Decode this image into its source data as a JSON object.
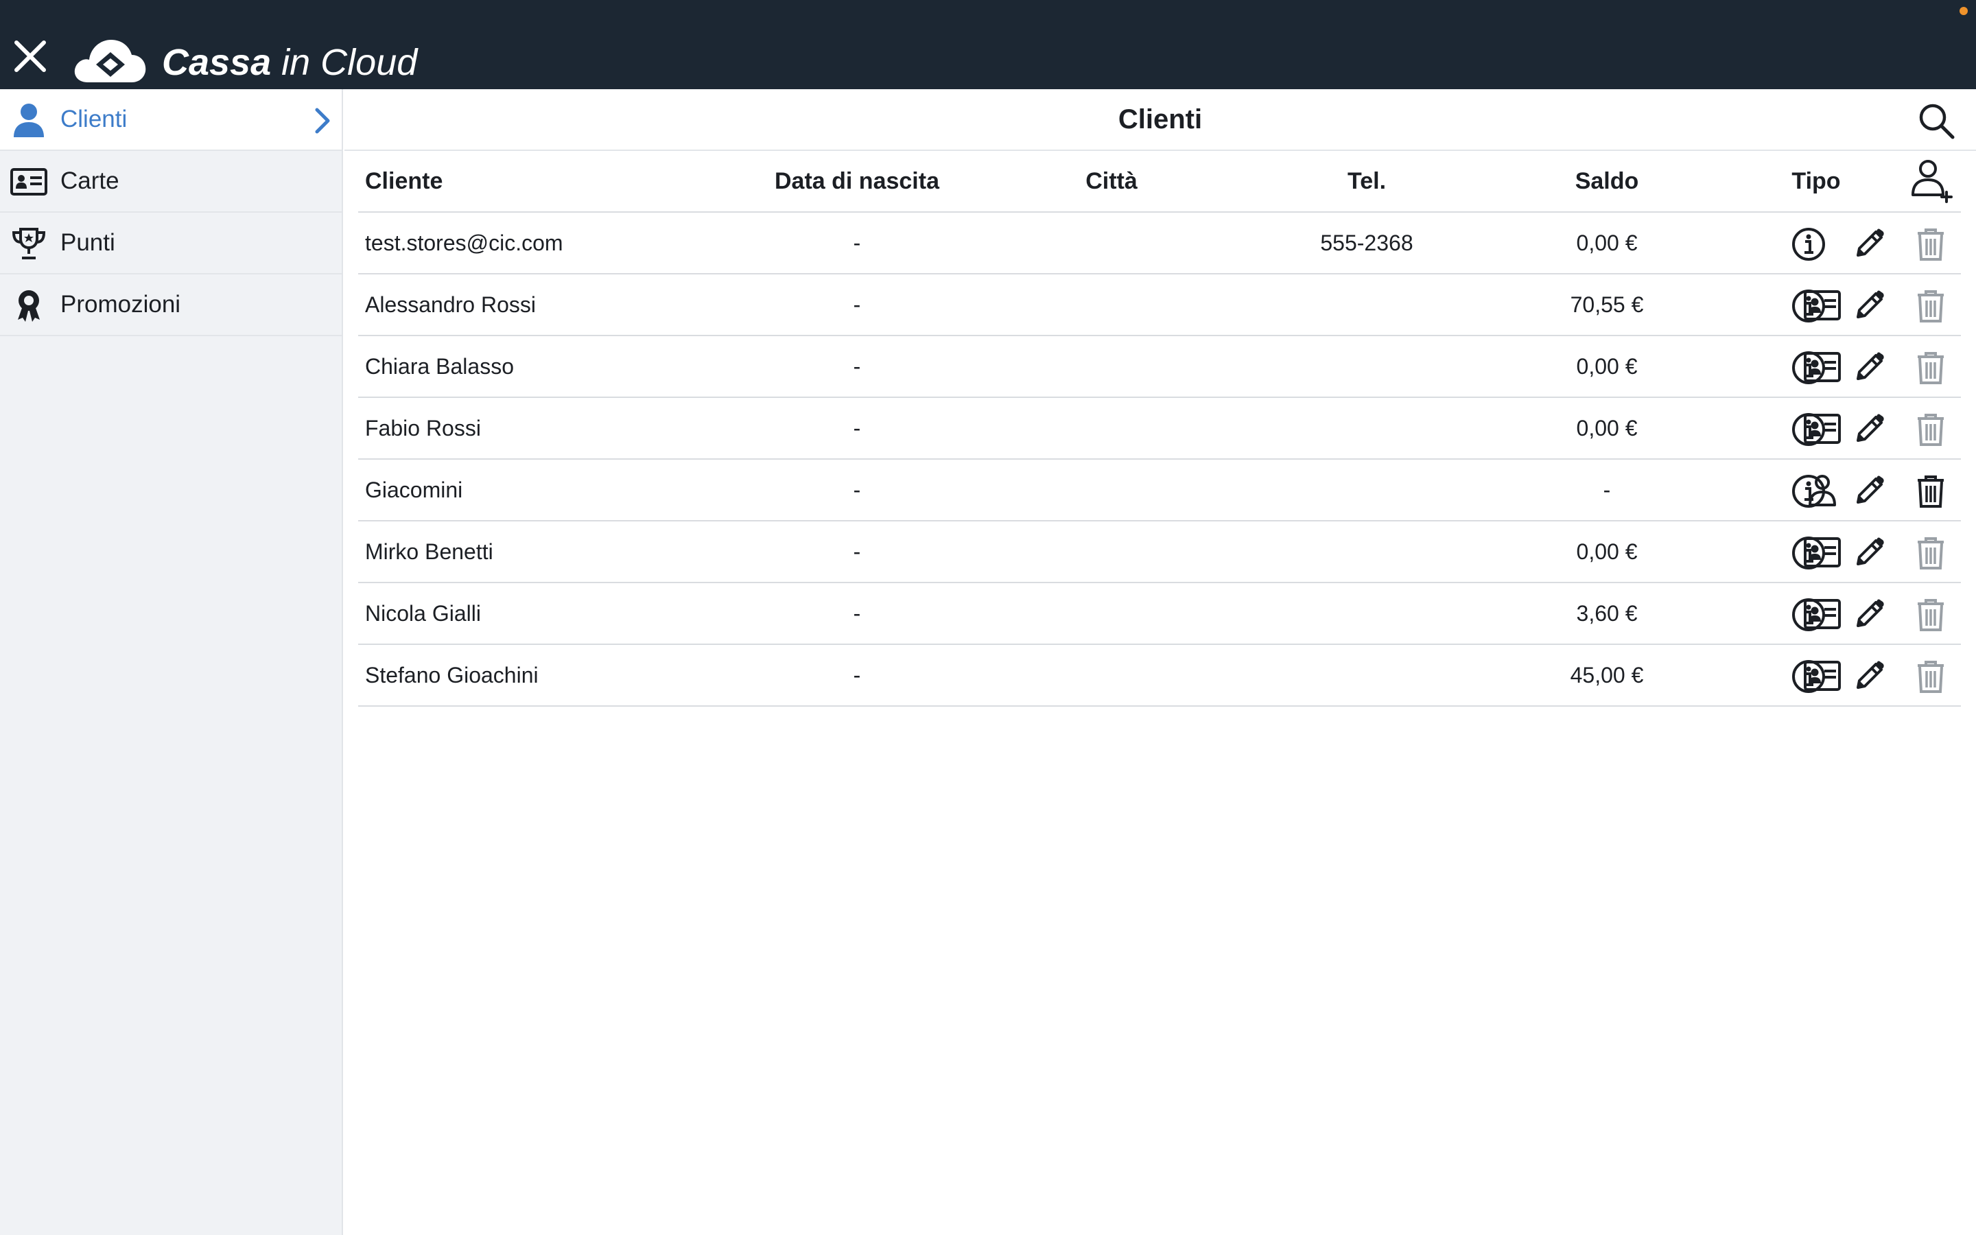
{
  "app": {
    "brand_bold": "Cassa",
    "brand_light": " in Cloud",
    "status_dot_color": "#f0932b",
    "header_bg": "#1c2733",
    "accent_color": "#3d7cc9"
  },
  "sidebar": {
    "items": [
      {
        "label": "Clienti",
        "icon": "user-icon",
        "active": true
      },
      {
        "label": "Carte",
        "icon": "id-card-icon",
        "active": false
      },
      {
        "label": "Punti",
        "icon": "trophy-icon",
        "active": false
      },
      {
        "label": "Promozioni",
        "icon": "ribbon-award-icon",
        "active": false
      }
    ]
  },
  "main": {
    "title": "Clienti",
    "columns": {
      "name": "Cliente",
      "dob": "Data di nascita",
      "city": "Città",
      "tel": "Tel.",
      "saldo": "Saldo",
      "tipo": "Tipo"
    },
    "rows": [
      {
        "name": "test.stores@cic.com",
        "dob": "-",
        "city": "",
        "tel": "555-2368",
        "saldo": "0,00 €",
        "tipo": "none",
        "delete_enabled": false
      },
      {
        "name": "Alessandro Rossi",
        "dob": "-",
        "city": "",
        "tel": "",
        "saldo": "70,55 €",
        "tipo": "id-card-icon",
        "delete_enabled": false
      },
      {
        "name": "Chiara Balasso",
        "dob": "-",
        "city": "",
        "tel": "",
        "saldo": "0,00 €",
        "tipo": "id-card-icon",
        "delete_enabled": false
      },
      {
        "name": "Fabio Rossi",
        "dob": "-",
        "city": "",
        "tel": "",
        "saldo": "0,00 €",
        "tipo": "id-card-icon",
        "delete_enabled": false
      },
      {
        "name": "Giacomini",
        "dob": "-",
        "city": "",
        "tel": "",
        "saldo": "-",
        "tipo": "user-icon",
        "delete_enabled": true
      },
      {
        "name": "Mirko Benetti",
        "dob": "-",
        "city": "",
        "tel": "",
        "saldo": "0,00 €",
        "tipo": "id-card-icon",
        "delete_enabled": false
      },
      {
        "name": "Nicola Gialli",
        "dob": "-",
        "city": "",
        "tel": "",
        "saldo": "3,60 €",
        "tipo": "id-card-icon",
        "delete_enabled": false
      },
      {
        "name": "Stefano Gioachini",
        "dob": "-",
        "city": "",
        "tel": "",
        "saldo": "45,00 €",
        "tipo": "id-card-icon",
        "delete_enabled": false
      }
    ]
  }
}
